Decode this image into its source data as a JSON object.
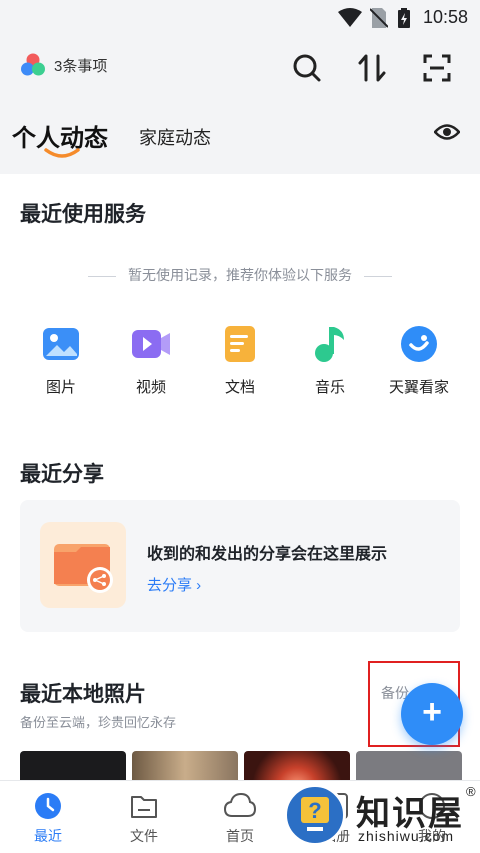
{
  "status_bar": {
    "time": "10:58"
  },
  "header": {
    "tasks_label": "3条事项"
  },
  "tabs": {
    "active": "个人动态",
    "other": "家庭动态"
  },
  "recent_services": {
    "title": "最近使用服务",
    "empty_hint": "暂无使用记录，推荐你体验以下服务",
    "items": [
      {
        "label": "图片",
        "icon": "image-icon",
        "color": "#3b8ff7"
      },
      {
        "label": "视频",
        "icon": "video-icon",
        "color": "#8b6cf2"
      },
      {
        "label": "文档",
        "icon": "document-icon",
        "color": "#f7b23b"
      },
      {
        "label": "音乐",
        "icon": "music-icon",
        "color": "#2dc98f"
      },
      {
        "label": "天翼看家",
        "icon": "home-camera-icon",
        "color": "#2f8df8"
      }
    ]
  },
  "recent_share": {
    "title": "最近分享",
    "message": "收到的和发出的分享会在这里展示",
    "action": "去分享 ›"
  },
  "local_photos": {
    "title": "最近本地照片",
    "subtitle": "备份至云端，珍贵回忆永存",
    "backup_label": "备份"
  },
  "bottom_nav": [
    {
      "label": "最近",
      "icon": "clock-icon",
      "active": true
    },
    {
      "label": "文件",
      "icon": "folder-icon",
      "active": false
    },
    {
      "label": "首页",
      "icon": "cloud-icon",
      "active": false
    },
    {
      "label": "相册",
      "icon": "album-icon",
      "active": false
    },
    {
      "label": "我的",
      "icon": "user-icon",
      "active": false
    }
  ],
  "watermark": {
    "text": "知识屋",
    "domain": "zhishiwu.com",
    "mark": "®"
  }
}
